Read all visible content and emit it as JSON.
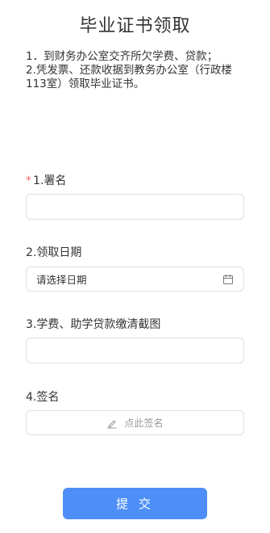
{
  "form": {
    "title": "毕业证书领取",
    "instructions": {
      "line1": "1．到财务办公室交齐所欠学费、贷款；",
      "line2": "2.凭发票、还款收据到教务办公室（行政楼113室）领取毕业证书。"
    },
    "fields": {
      "name": {
        "required_mark": "*",
        "label": "1.署名",
        "value": ""
      },
      "date": {
        "label": "2.领取日期",
        "placeholder": "请选择日期",
        "icon": "calendar-icon"
      },
      "screenshot": {
        "label": "3.学费、助学贷款缴清截图",
        "value": ""
      },
      "signature": {
        "label": "4.签名",
        "button_text": "点此签名",
        "icon": "pen-icon"
      }
    },
    "submit_label": "提 交"
  },
  "colors": {
    "primary": "#4e8ef7",
    "required": "#f56c6c",
    "border": "#dcdfe6",
    "muted_text": "#999999"
  }
}
